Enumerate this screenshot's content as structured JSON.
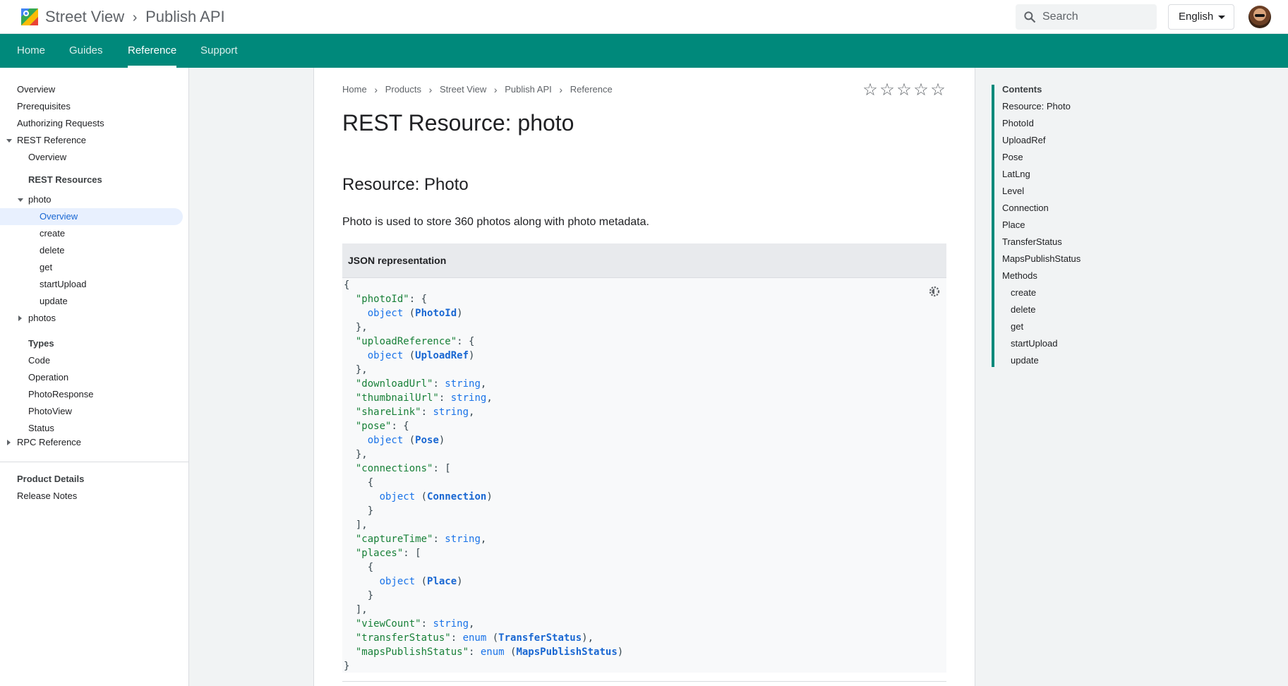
{
  "header": {
    "product": "Street View",
    "separator": ">",
    "section": "Publish API",
    "search_placeholder": "Search",
    "language": "English"
  },
  "tabs": [
    "Home",
    "Guides",
    "Reference",
    "Support"
  ],
  "active_tab": "Reference",
  "sidebar": {
    "items": [
      {
        "label": "Overview"
      },
      {
        "label": "Prerequisites"
      },
      {
        "label": "Authorizing Requests"
      },
      {
        "label": "REST Reference"
      },
      {
        "label": "Overview"
      },
      {
        "label": "REST Resources"
      },
      {
        "label": "photo"
      },
      {
        "label": "Overview"
      },
      {
        "label": "create"
      },
      {
        "label": "delete"
      },
      {
        "label": "get"
      },
      {
        "label": "startUpload"
      },
      {
        "label": "update"
      },
      {
        "label": "photos"
      },
      {
        "label": "Types"
      },
      {
        "label": "Code"
      },
      {
        "label": "Operation"
      },
      {
        "label": "PhotoResponse"
      },
      {
        "label": "PhotoView"
      },
      {
        "label": "Status"
      },
      {
        "label": "RPC Reference"
      },
      {
        "label": "Product Details"
      },
      {
        "label": "Release Notes"
      }
    ],
    "active_item": "photo > Overview"
  },
  "breadcrumb": [
    "Home",
    "Products",
    "Street View",
    "Publish API",
    "Reference"
  ],
  "rating": {
    "stars": 5,
    "filled": 0
  },
  "page": {
    "title": "REST Resource: photo",
    "section_title": "Resource: Photo",
    "description": "Photo is used to store 360 photos along with photo metadata.",
    "json_header": "JSON representation"
  },
  "code": {
    "open_brace": "{",
    "close_brace": "}",
    "photoId": "\"photoId\"",
    "uploadReference": "\"uploadReference\"",
    "downloadUrl": "\"downloadUrl\"",
    "thumbnailUrl": "\"thumbnailUrl\"",
    "shareLink": "\"shareLink\"",
    "pose": "\"pose\"",
    "connections": "\"connections\"",
    "captureTime": "\"captureTime\"",
    "places": "\"places\"",
    "viewCount": "\"viewCount\"",
    "transferStatus": "\"transferStatus\"",
    "mapsPublishStatus": "\"mapsPublishStatus\"",
    "object": "object",
    "string": "string",
    "enum": "enum",
    "PhotoId": "PhotoId",
    "UploadRef": "UploadRef",
    "Pose": "Pose",
    "Connection": "Connection",
    "Place": "Place",
    "TransferStatus": "TransferStatus",
    "MapsPublishStatus": "MapsPublishStatus"
  },
  "toc": {
    "title": "Contents",
    "items": [
      "Resource: Photo",
      "PhotoId",
      "UploadRef",
      "Pose",
      "LatLng",
      "Level",
      "Connection",
      "Place",
      "TransferStatus",
      "MapsPublishStatus",
      "Methods",
      "create",
      "delete",
      "get",
      "startUpload",
      "update"
    ]
  },
  "colors": {
    "brand_teal": "#00897b",
    "link_blue": "#1967d2",
    "json_key_green": "#188038"
  },
  "icons": [
    "maps-logo-icon",
    "chevron-right-icon",
    "search-icon",
    "caret-down-icon",
    "star-outline-icon",
    "theme-toggle-icon",
    "triangle-down-icon",
    "triangle-right-icon"
  ]
}
